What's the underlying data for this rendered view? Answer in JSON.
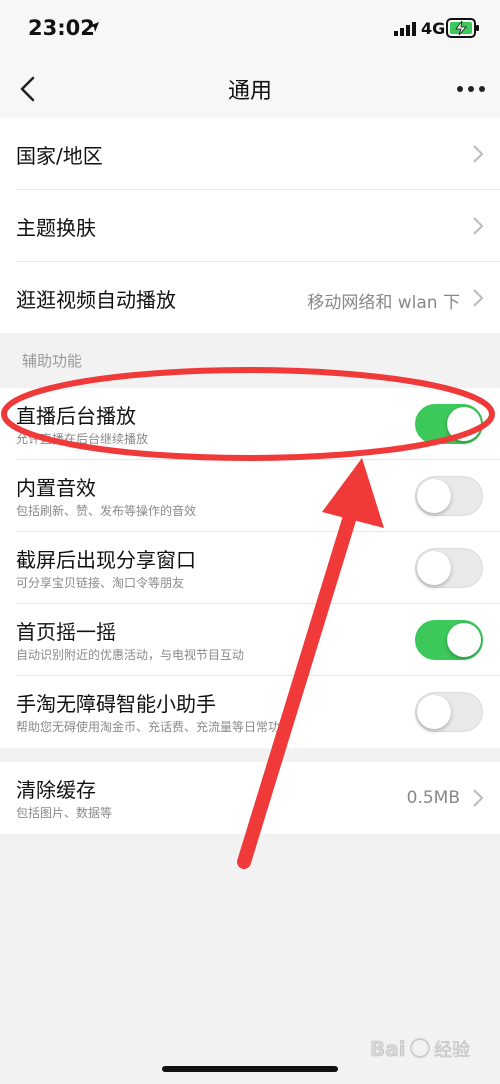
{
  "status_bar": {
    "time": "23:02",
    "network": "4G"
  },
  "nav": {
    "title": "通用"
  },
  "general_items": [
    {
      "label": "国家/地区"
    },
    {
      "label": "主题换肤"
    },
    {
      "label": "逛逛视频自动播放",
      "value": "移动网络和 wlan 下"
    }
  ],
  "accessibility": {
    "header": "辅助功能",
    "items": [
      {
        "label": "直播后台播放",
        "sub": "允许直播在后台继续播放",
        "enabled": true
      },
      {
        "label": "内置音效",
        "sub": "包括刷新、赞、发布等操作的音效",
        "enabled": false
      },
      {
        "label": "截屏后出现分享窗口",
        "sub": "可分享宝贝链接、淘口令等朋友",
        "enabled": false
      },
      {
        "label": "首页摇一摇",
        "sub": "自动识别附近的优惠活动，与电视节目互动",
        "enabled": true
      },
      {
        "label": "手淘无障碍智能小助手",
        "sub": "帮助您无碍使用淘金币、充话费、充流量等日常功能",
        "enabled": false
      }
    ]
  },
  "cache": {
    "label": "清除缓存",
    "sub": "包括图片、数据等",
    "value": "0.5MB"
  },
  "watermark": "Bai 经验",
  "colors": {
    "toggle_on": "#3cc85a",
    "annotation": "#f03a3a"
  }
}
